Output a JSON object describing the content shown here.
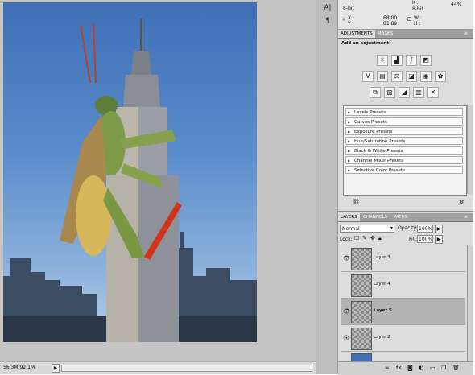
{
  "status": {
    "doc_size": "56.3M/92.1M",
    "nav_arrow": "▶"
  },
  "strip": {
    "icon1": "A|",
    "icon2": "¶"
  },
  "info": {
    "bit1": "8-bit",
    "k_label": "K :",
    "percent": "44%",
    "bit2": "8-bit",
    "x_label": "X :",
    "x_val": "68.00",
    "y_label": "Y :",
    "y_val": "81.89",
    "w_label": "W :",
    "h_label": "H :"
  },
  "adjustments": {
    "tabs": [
      "ADJUSTMENTS",
      "MASKS"
    ],
    "heading": "Add an adjustment",
    "presets": [
      "Levels Presets",
      "Curves Presets",
      "Exposure Presets",
      "Hue/Saturation Presets",
      "Black & White Presets",
      "Channel Mixer Presets",
      "Selective Color Presets"
    ]
  },
  "layers": {
    "tabs": [
      "LAYERS",
      "CHANNELS",
      "PATHS"
    ],
    "blend_mode": "Normal",
    "opacity_label": "Opacity:",
    "opacity": "100%",
    "lock_label": "Lock:",
    "fill_label": "Fill:",
    "fill": "100%",
    "items": [
      {
        "name": "Layer 3"
      },
      {
        "name": "Layer 4"
      },
      {
        "name": "Layer 5"
      },
      {
        "name": "Layer 2"
      }
    ]
  }
}
